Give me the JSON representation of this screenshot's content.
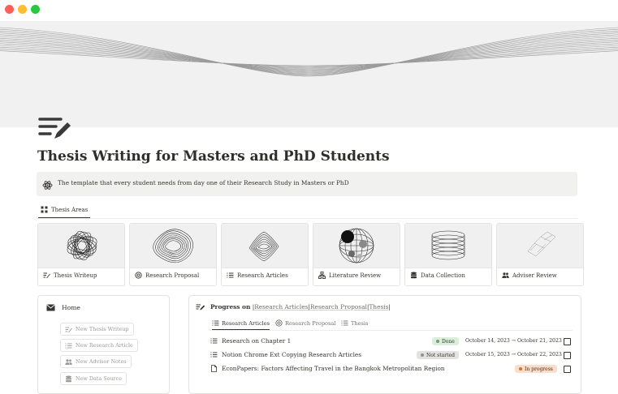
{
  "window": {
    "controls": [
      "close",
      "minimize",
      "maximize"
    ]
  },
  "page": {
    "icon": "pen-lines-icon",
    "title": "Thesis Writing for Masters and PhD Students",
    "callout": {
      "icon": "atom-icon",
      "text": "The template that every student needs from day one  of their Research Study in Masters or PhD"
    }
  },
  "tabs": {
    "active_label": "Thesis Areas",
    "active_icon": "grid-icon"
  },
  "areas": [
    {
      "label": "Thesis Writeup",
      "icon": "pen-lines-icon"
    },
    {
      "label": "Research Proposal",
      "icon": "target-icon"
    },
    {
      "label": "Research Articles",
      "icon": "list-icon"
    },
    {
      "label": "Literature Review",
      "icon": "network-icon"
    },
    {
      "label": "Data Collection",
      "icon": "database-icon"
    },
    {
      "label": "Adviser Review",
      "icon": "people-icon"
    }
  ],
  "home": {
    "title": "Home",
    "icon": "mail-icon",
    "buttons": [
      {
        "label": "New Thesis Writeup",
        "icon": "pen-lines-icon"
      },
      {
        "label": "New Research Article",
        "icon": "list-icon"
      },
      {
        "label": "New Advisor Notes",
        "icon": "people-icon"
      },
      {
        "label": "New Data Source",
        "icon": "database-icon"
      }
    ]
  },
  "progress": {
    "prefix": "Progress on",
    "sep1": "|",
    "link1": "Research Articles",
    "sep2": "|",
    "link2": "Research Proposal",
    "sep3": "|",
    "link3": "Thesis",
    "sep4": "|",
    "tabs": [
      {
        "label": "Research Articles",
        "icon": "list-icon",
        "active": true
      },
      {
        "label": "Research Proposal",
        "icon": "target-icon",
        "active": false
      },
      {
        "label": "Thesis",
        "icon": "list-icon",
        "active": false
      }
    ],
    "rows": [
      {
        "title": "Research on Chapter 1",
        "icon": "list-icon",
        "status": "Done",
        "date": "October 14, 2023 → October 21, 2023",
        "checked": false
      },
      {
        "title": "Notion Chrome Ext Copying Research Articles",
        "icon": "list-icon",
        "status": "Not started",
        "date": "October 15, 2023 → October 22, 2023",
        "checked": false
      },
      {
        "title": "EconPapers: Factors Affecting Travel in the Bangkok Metropolitan Region",
        "icon": "page-icon",
        "status": "In progress",
        "date": "",
        "checked": false
      }
    ]
  },
  "colors": {
    "done": "#dbeddb",
    "not_started": "#e3e2e0",
    "in_progress": "#fadec9",
    "text": "#37352f"
  }
}
